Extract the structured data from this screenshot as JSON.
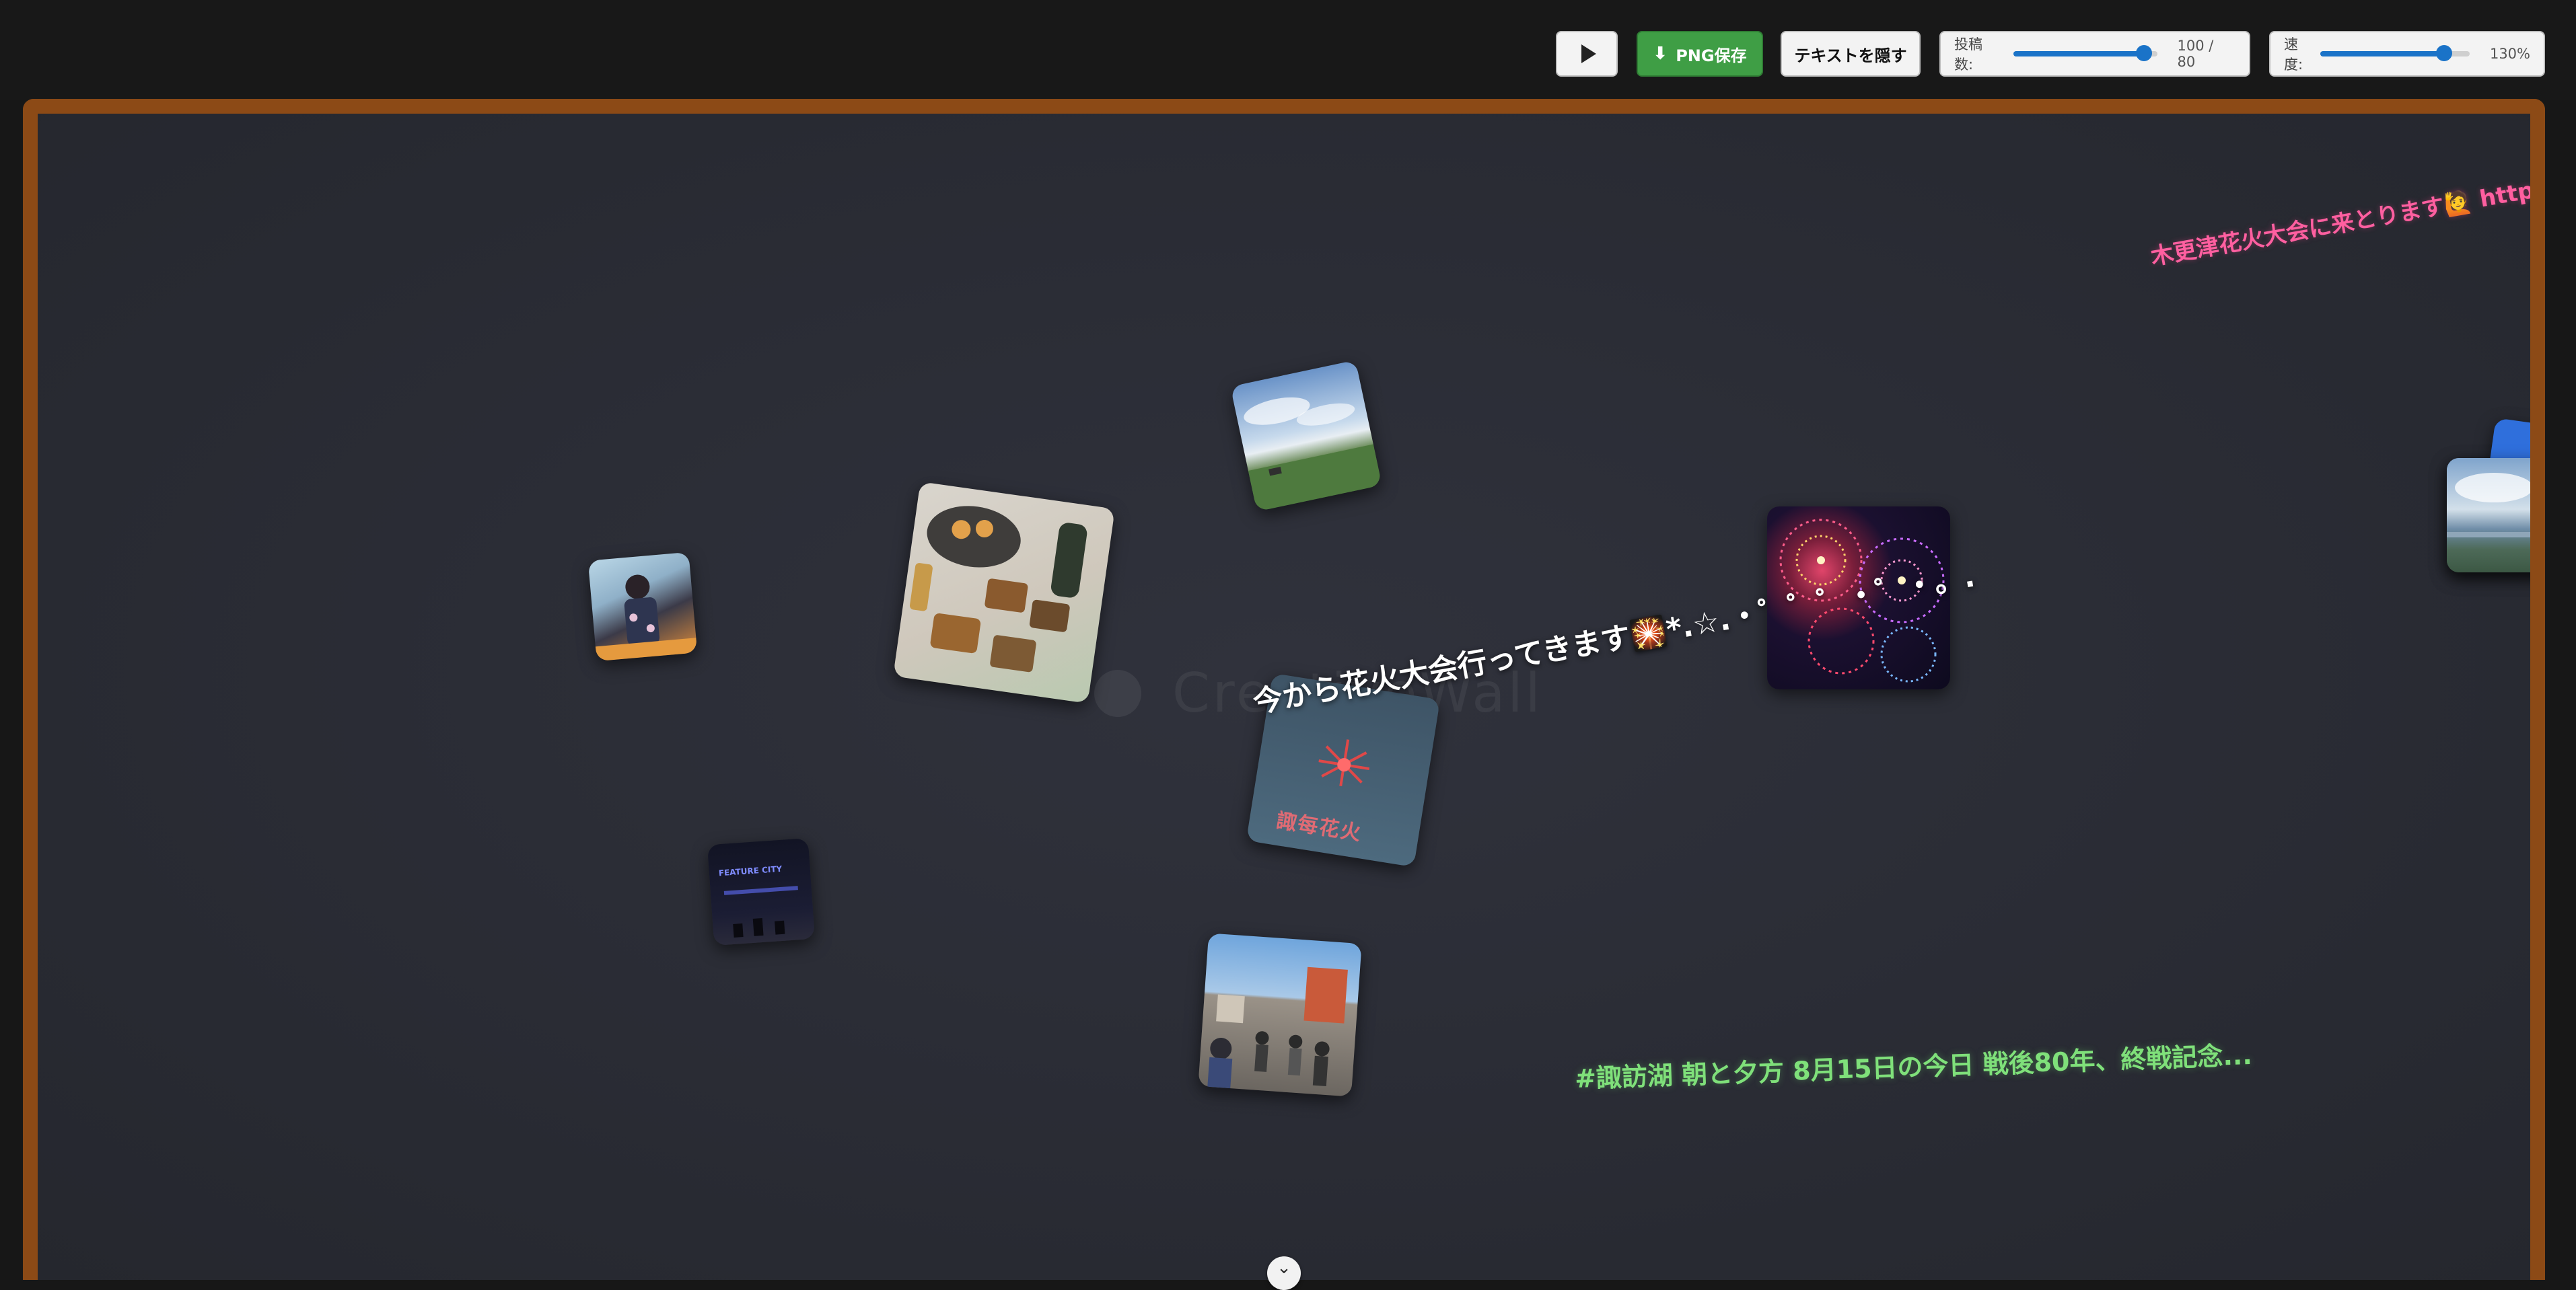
{
  "toolbar": {
    "play_icon": "play-icon",
    "save_label": "PNG保存",
    "save_icon": "download-icon",
    "hide_text_label": "テキストを隠す",
    "post_count": {
      "label": "投稿数:",
      "value_text": "100 / 80",
      "fill_fraction": 0.91
    },
    "speed": {
      "label": "速度:",
      "value_text": "130%",
      "fill_fraction": 0.83
    },
    "accent_color": "#1a73c8",
    "save_color": "#3f9e45"
  },
  "board": {
    "frame_color": "#8c4a16",
    "background_color": "#2b2d36",
    "watermark": "CreativeWall",
    "watermark_icon": "palette-icon"
  },
  "scroll_texts": {
    "main": "今から花火大会行ってきます🎇*.☆.・゜゜゜・゜・。.",
    "pink": "木更津花火大会に来とります🙋 https:/",
    "green": "#諏訪湖 朝と夕方 8月15日の今日 戦後80年、終戦記念..."
  },
  "photos": {
    "drone_text": "諏每花火",
    "night_text": "FEATURE CITY"
  },
  "bottom_handle_icon": "chevron-down-icon"
}
